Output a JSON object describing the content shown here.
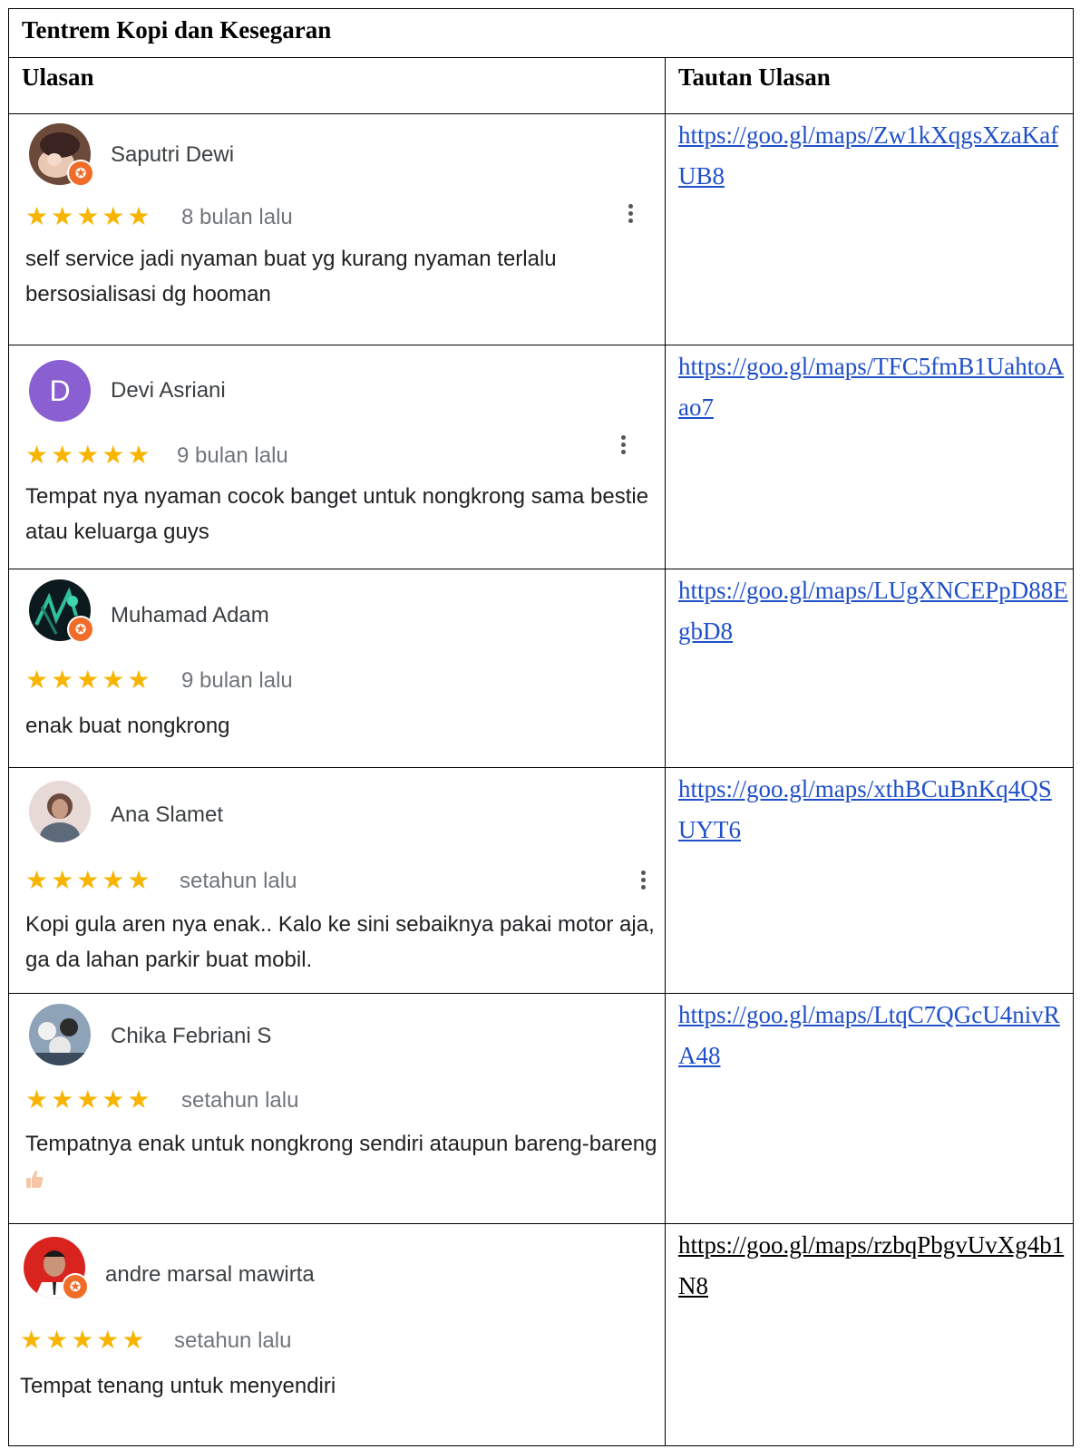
{
  "title": "Tentrem Kopi dan Kesegaran",
  "headers": {
    "review": "Ulasan",
    "link": "Tautan Ulasan"
  },
  "colors": {
    "star": "#f7b400",
    "link": "#1f4fc9",
    "badge": "#ef6c29",
    "letter_avatar": "#8a5fd1"
  },
  "reviews": [
    {
      "name": "Saputri Dewi",
      "stars": "★★★★★",
      "rating": 5,
      "time": "8 bulan lalu",
      "text": "self service jadi nyaman buat yg kurang nyaman terlalu bersosialisasi dg hooman",
      "link": "https://goo.gl/maps/Zw1kXqgsXzaKafUB8",
      "avatar_icon": "profile-photo",
      "local_guide": true
    },
    {
      "name": "Devi Asriani",
      "stars": "★★★★★",
      "rating": 5,
      "time": "9 bulan lalu",
      "text": "Tempat nya nyaman cocok banget untuk nongkrong sama bestie atau keluarga guys",
      "link": "https://goo.gl/maps/TFC5fmB1UahtoAao7",
      "avatar_letter": "D",
      "local_guide": false
    },
    {
      "name": "Muhamad Adam",
      "stars": "★★★★★",
      "rating": 5,
      "time": "9 bulan lalu",
      "text": "enak buat nongkrong",
      "link": "https://goo.gl/maps/LUgXNCEPpD88EgbD8",
      "avatar_icon": "profile-photo",
      "local_guide": true
    },
    {
      "name": "Ana Slamet",
      "stars": "★★★★★",
      "rating": 5,
      "time": "setahun lalu",
      "text": "Kopi gula aren nya enak.. Kalo ke sini sebaiknya pakai motor aja, ga da lahan parkir buat mobil.",
      "link": "https://goo.gl/maps/xthBCuBnKq4QSUYT6",
      "avatar_icon": "profile-photo",
      "local_guide": false
    },
    {
      "name": "Chika Febriani S",
      "stars": "★★★★★",
      "rating": 5,
      "time": "setahun lalu",
      "text": "Tempatnya enak untuk nongkrong sendiri ataupun bareng-bareng",
      "emoji_icon": "thumbs-up-icon",
      "link": "https://goo.gl/maps/LtqC7QGcU4nivRA48",
      "avatar_icon": "profile-photo",
      "local_guide": false
    },
    {
      "name": "andre marsal mawirta",
      "stars": "★★★★★",
      "rating": 5,
      "time": "setahun lalu",
      "text": "Tempat tenang untuk menyendiri",
      "link": "https://goo.gl/maps/rzbqPbgvUvXg4b1N8",
      "avatar_icon": "profile-photo",
      "local_guide": true
    }
  ]
}
